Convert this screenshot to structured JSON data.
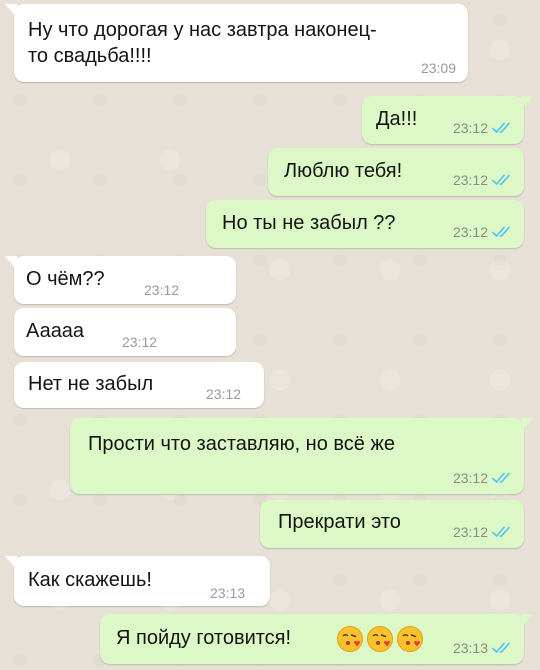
{
  "colors": {
    "incoming_bubble": "#ffffff",
    "outgoing_bubble": "#dcf8c6",
    "read_ticks": "#4fc3f7",
    "wallpaper": "#e6e0d6"
  },
  "messages": [
    {
      "direction": "in",
      "lines": [
        "Ну что дорогая у нас завтра наконец-",
        "то свадьба!!!!"
      ],
      "time": "23:09"
    },
    {
      "direction": "out",
      "text": "Да!!!",
      "time": "23:12",
      "status": "read"
    },
    {
      "direction": "out",
      "text": "Люблю тебя!",
      "time": "23:12",
      "status": "read"
    },
    {
      "direction": "out",
      "text": "Но ты не забыл ??",
      "time": "23:12",
      "status": "read"
    },
    {
      "direction": "in",
      "text": "О чём??",
      "time": "23:12"
    },
    {
      "direction": "in",
      "text": "Ааааа",
      "time": "23:12"
    },
    {
      "direction": "in",
      "text": "Нет не забыл",
      "time": "23:12"
    },
    {
      "direction": "out",
      "text": "Прости что заставляю, но всё же",
      "time": "23:12",
      "status": "read"
    },
    {
      "direction": "out",
      "text": "Прекрати это",
      "time": "23:12",
      "status": "read"
    },
    {
      "direction": "in",
      "text": "Как скажешь!",
      "time": "23:13"
    },
    {
      "direction": "out",
      "text": "Я пойду готовится!",
      "emojis": [
        "kissing-face-heart-emoji",
        "kissing-face-heart-emoji",
        "kissing-face-heart-emoji"
      ],
      "time": "23:13",
      "status": "read"
    }
  ]
}
